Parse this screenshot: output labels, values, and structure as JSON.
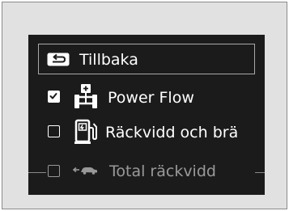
{
  "menu": {
    "back_label": "Tillbaka",
    "items": [
      {
        "label": "Power Flow",
        "checked": true,
        "icon": "power-flow-icon"
      },
      {
        "label": "Räckvidd och brä",
        "checked": false,
        "icon": "fuel-pump-icon"
      },
      {
        "label": "Total räckvidd",
        "checked": false,
        "icon": "car-range-icon"
      }
    ]
  },
  "colors": {
    "frame_background": "#e1e1e1",
    "screen_background": "#1b1b1b",
    "text": "#ffffff",
    "border": "#a9a9a9"
  }
}
